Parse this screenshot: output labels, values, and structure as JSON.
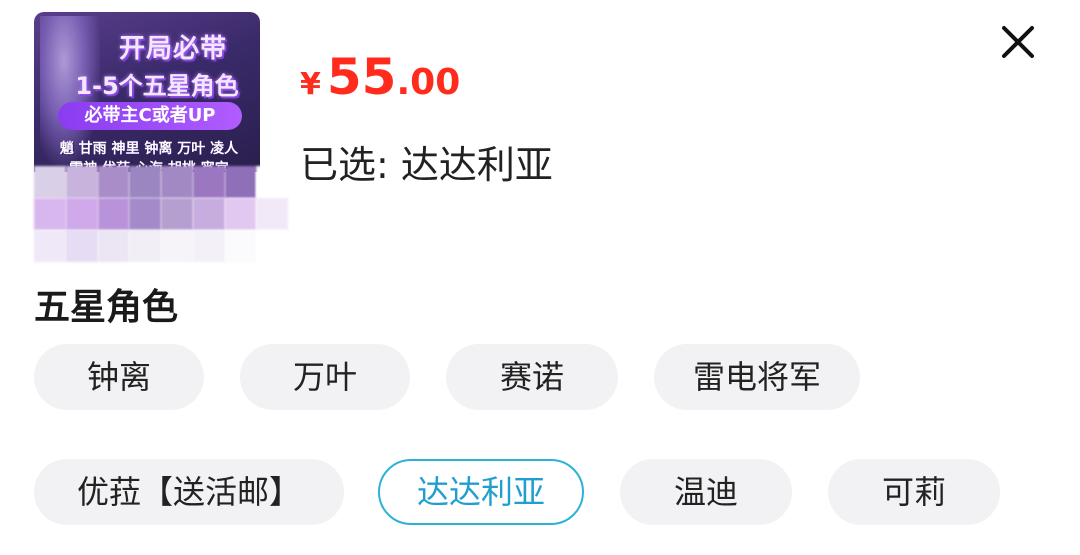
{
  "product": {
    "thumbnail": {
      "title_line1": "开局必带",
      "title_line2": "1-5个五星角色",
      "pill": "必带主C或者UP",
      "names_row1": "魈 甘雨 神里 钟离 万叶 凌人",
      "names_row2": "雷神 优菈 心海 胡桃 宵宫"
    },
    "price": {
      "currency": "¥",
      "integer": "55",
      "decimal": ".00"
    },
    "selected_text": "已选: 达达利亚"
  },
  "close_icon": "close-icon",
  "section": {
    "title": "五星角色",
    "options": [
      {
        "label": "钟离",
        "selected": false
      },
      {
        "label": "万叶",
        "selected": false
      },
      {
        "label": "赛诺",
        "selected": false
      },
      {
        "label": "雷电将军",
        "selected": false
      },
      {
        "label": "优菈【送活邮】",
        "selected": false
      },
      {
        "label": "达达利亚",
        "selected": true
      },
      {
        "label": "温迪",
        "selected": false
      },
      {
        "label": "可莉",
        "selected": false
      }
    ]
  },
  "colors": {
    "price": "#ff2b1c",
    "accent": "#2bb3d6",
    "chip_bg": "#f2f2f4"
  }
}
